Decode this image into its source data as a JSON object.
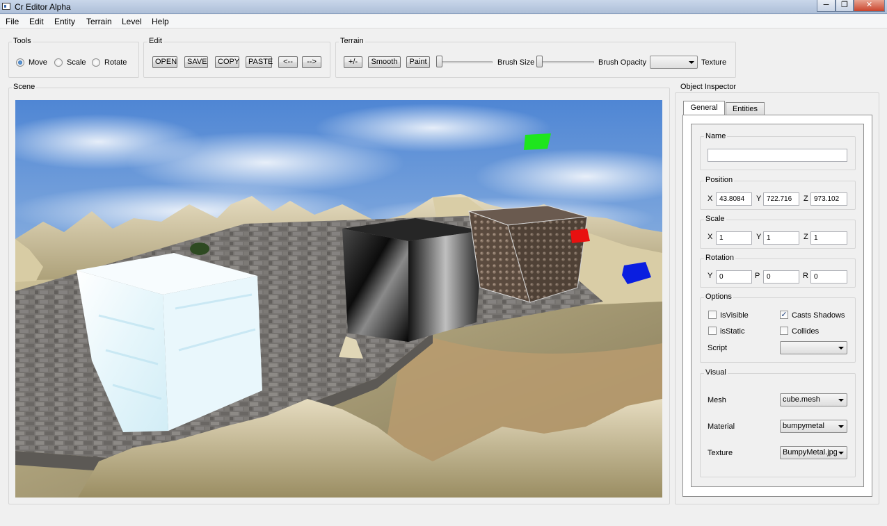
{
  "window": {
    "title": "Cr Editor Alpha",
    "min": "─",
    "max": "❐",
    "close": "✕"
  },
  "menu": [
    "File",
    "Edit",
    "Entity",
    "Terrain",
    "Level",
    "Help"
  ],
  "tools": {
    "title": "Tools",
    "options": [
      "Move",
      "Scale",
      "Rotate"
    ],
    "selected": "Move"
  },
  "edit": {
    "title": "Edit",
    "buttons": [
      "OPEN",
      "SAVE",
      "COPY",
      "PASTE",
      "<--",
      "-->"
    ]
  },
  "terrain": {
    "title": "Terrain",
    "buttons": [
      "+/-",
      "Smooth",
      "Paint"
    ],
    "brush_size_label": "Brush Size",
    "brush_opacity_label": "Brush Opacity",
    "texture_label": "Texture",
    "texture_value": "",
    "brush_size_level": 0,
    "brush_opacity_level": 0
  },
  "scene": {
    "title": "Scene"
  },
  "inspector": {
    "title": "Object Inspector",
    "tabs": [
      "General",
      "Entities"
    ],
    "active_tab": "General",
    "name": {
      "title": "Name",
      "value": ""
    },
    "position": {
      "title": "Position",
      "x_label": "X",
      "y_label": "Y",
      "z_label": "Z",
      "x": "43.8084",
      "y": "722.716",
      "z": "973.102"
    },
    "scale": {
      "title": "Scale",
      "x_label": "X",
      "y_label": "Y",
      "z_label": "Z",
      "x": "1",
      "y": "1",
      "z": "1"
    },
    "rotation": {
      "title": "Rotation",
      "y_label": "Y",
      "p_label": "P",
      "r_label": "R",
      "y": "0",
      "p": "0",
      "r": "0"
    },
    "options": {
      "title": "Options",
      "is_visible_label": "IsVisible",
      "is_visible": false,
      "casts_shadows_label": "Casts Shadows",
      "casts_shadows": true,
      "is_static_label": "isStatic",
      "is_static": false,
      "collides_label": "Collides",
      "collides": false,
      "script_label": "Script",
      "script_value": ""
    },
    "visual": {
      "title": "Visual",
      "mesh_label": "Mesh",
      "mesh_value": "cube.mesh",
      "material_label": "Material",
      "material_value": "bumpymetal",
      "texture_label": "Texture",
      "texture_value": "BumpyMetal.jpg"
    }
  },
  "colors": {
    "sky": "#5f90d2",
    "marker_green": "#1ee61e",
    "marker_red": "#e81010",
    "marker_blue": "#0a1ee0"
  }
}
